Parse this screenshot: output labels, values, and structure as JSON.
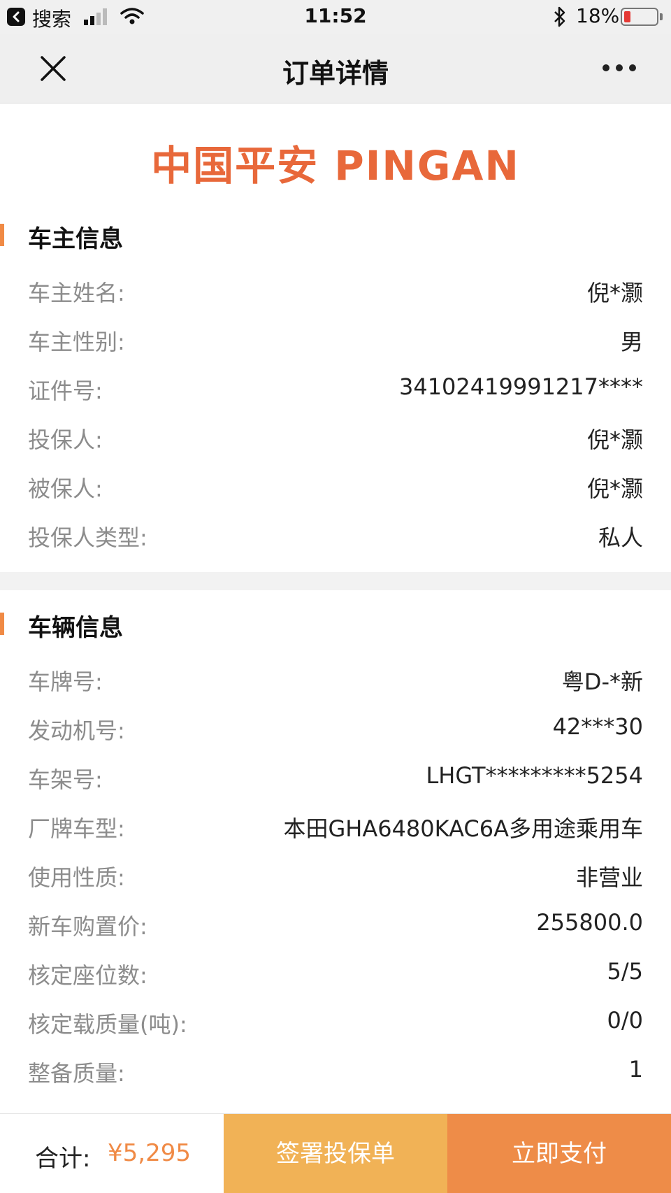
{
  "status_bar": {
    "back_app": "搜索",
    "time": "11:52",
    "battery": "18%"
  },
  "nav": {
    "title": "订单详情"
  },
  "logo": {
    "text": "中国平安 PINGAN"
  },
  "owner_section": {
    "title": "车主信息",
    "rows": [
      {
        "label": "车主姓名:",
        "value": "倪*灏"
      },
      {
        "label": "车主性别:",
        "value": "男"
      },
      {
        "label": "证件号:",
        "value": "34102419991217****"
      },
      {
        "label": "投保人:",
        "value": "倪*灏"
      },
      {
        "label": "被保人:",
        "value": "倪*灏"
      },
      {
        "label": "投保人类型:",
        "value": "私人"
      }
    ]
  },
  "vehicle_section": {
    "title": "车辆信息",
    "rows": [
      {
        "label": "车牌号:",
        "value": "粤D-*新"
      },
      {
        "label": "发动机号:",
        "value": "42***30"
      },
      {
        "label": "车架号:",
        "value": "LHGT*********5254"
      },
      {
        "label": "厂牌车型:",
        "value": "本田GHA6480KAC6A多用途乘用车"
      },
      {
        "label": "使用性质:",
        "value": "非营业"
      },
      {
        "label": "新车购置价:",
        "value": "255800.0"
      },
      {
        "label": "核定座位数:",
        "value": "5/5"
      },
      {
        "label": "核定载质量(吨):",
        "value": "0/0"
      },
      {
        "label": "整备质量:",
        "value": "1"
      }
    ]
  },
  "bottom": {
    "total_label": "合计:",
    "total_amount": "¥5,295",
    "sign_button": "签署投保单",
    "pay_button": "立即支付"
  }
}
